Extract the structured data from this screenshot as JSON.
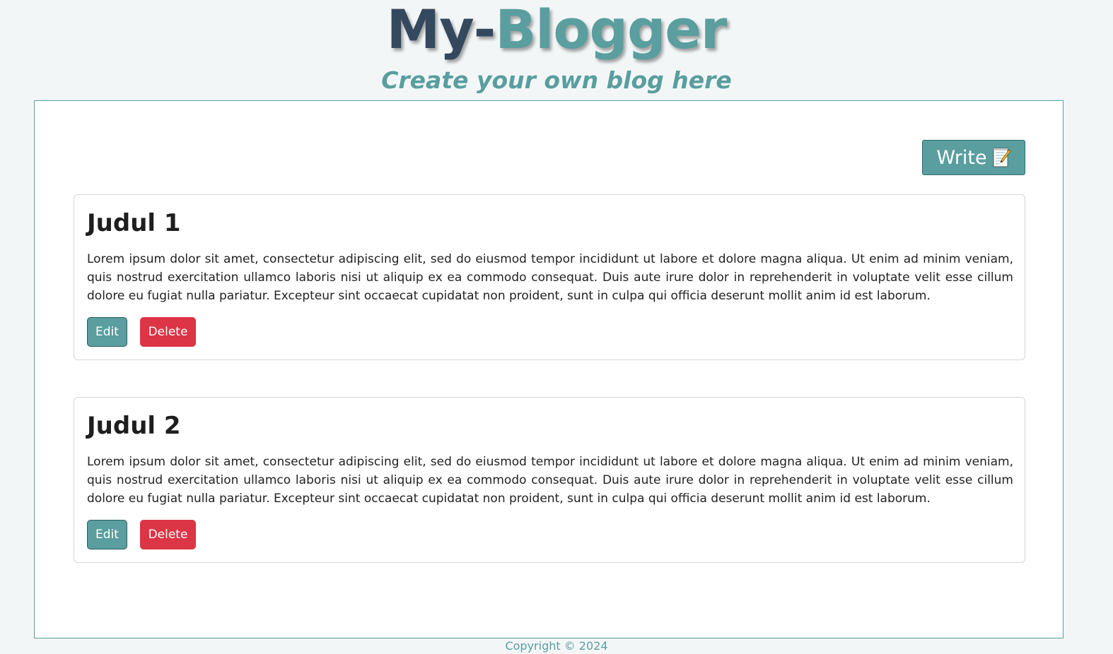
{
  "header": {
    "brand_part1": "My-",
    "brand_part2": "Blogger",
    "tagline": "Create your own blog here"
  },
  "toolbar": {
    "write_label": "Write",
    "write_icon": "memo-icon"
  },
  "posts": [
    {
      "title": "Judul 1",
      "body": "Lorem ipsum dolor sit amet, consectetur adipiscing elit, sed do eiusmod tempor incididunt ut labore et dolore magna aliqua. Ut enim ad minim veniam, quis nostrud exercitation ullamco laboris nisi ut aliquip ex ea commodo consequat. Duis aute irure dolor in reprehenderit in voluptate velit esse cillum dolore eu fugiat nulla pariatur. Excepteur sint occaecat cupidatat non proident, sunt in culpa qui officia deserunt mollit anim id est laborum.",
      "edit_label": "Edit",
      "delete_label": "Delete"
    },
    {
      "title": "Judul 2",
      "body": "Lorem ipsum dolor sit amet, consectetur adipiscing elit, sed do eiusmod tempor incididunt ut labore et dolore magna aliqua. Ut enim ad minim veniam, quis nostrud exercitation ullamco laboris nisi ut aliquip ex ea commodo consequat. Duis aute irure dolor in reprehenderit in voluptate velit esse cillum dolore eu fugiat nulla pariatur. Excepteur sint occaecat cupidatat non proident, sunt in culpa qui officia deserunt mollit anim id est laborum.",
      "edit_label": "Edit",
      "delete_label": "Delete"
    }
  ],
  "footer": {
    "copyright": "Copyright © 2024"
  },
  "colors": {
    "accent": "#5a9e9f",
    "brand_dark": "#34495e",
    "danger": "#dc3545",
    "page_background": "#f3f6f7"
  }
}
